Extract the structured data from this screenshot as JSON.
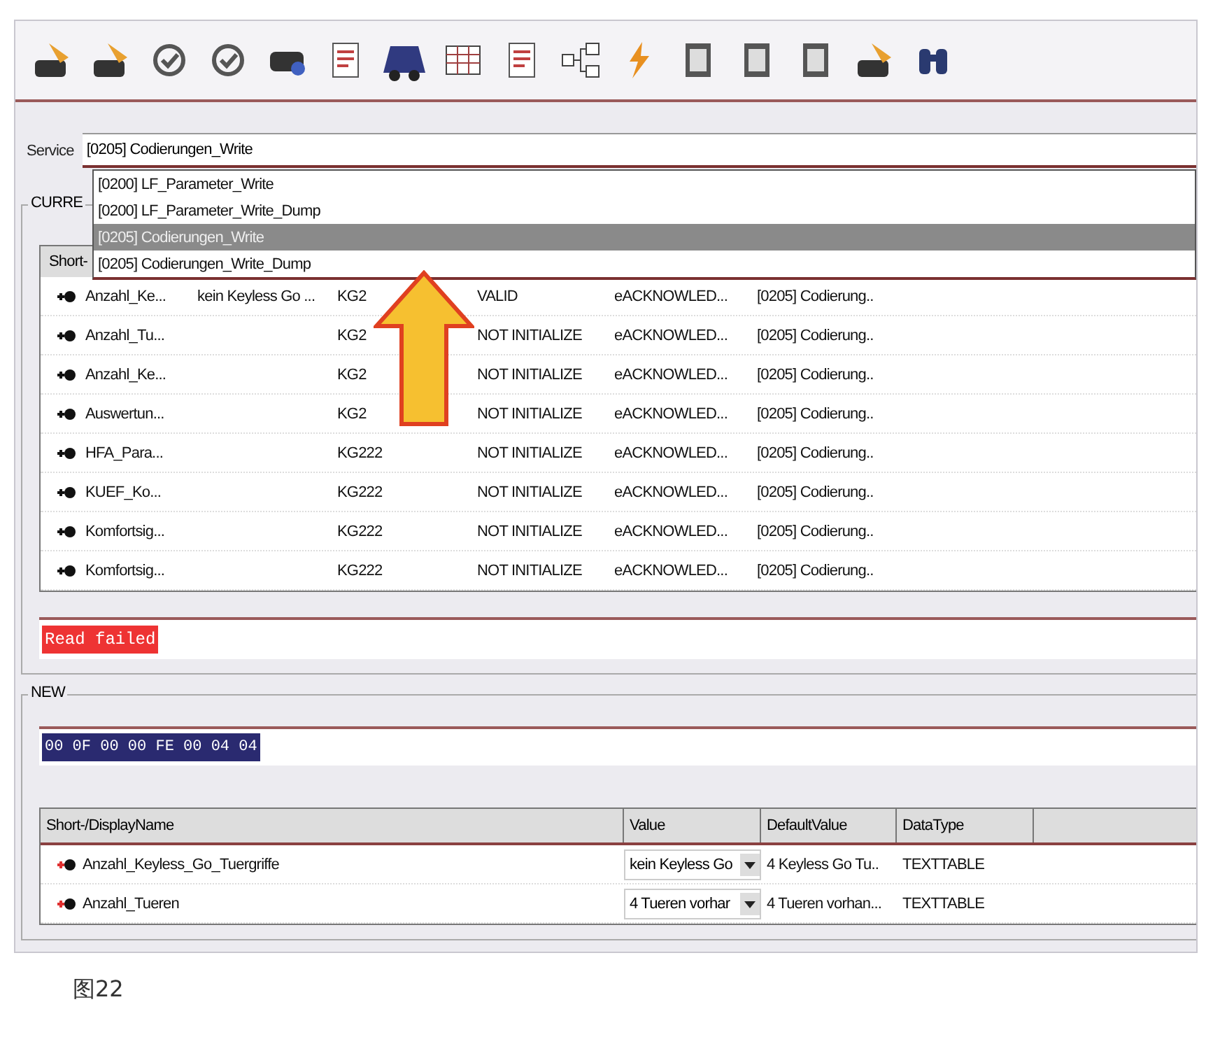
{
  "service": {
    "label": "Service",
    "value": "[0205] Codierungen_Write"
  },
  "dropdown": {
    "options": [
      {
        "label": "[0200] LF_Parameter_Write",
        "selected": false
      },
      {
        "label": "[0200] LF_Parameter_Write_Dump",
        "selected": false
      },
      {
        "label": "[0205] Codierungen_Write",
        "selected": true
      },
      {
        "label": "[0205] Codierungen_Write_Dump",
        "selected": false
      }
    ]
  },
  "current": {
    "title": "CURRE",
    "header": "Short-",
    "rows": [
      {
        "name": "Anzahl_Ke...",
        "value": "kein Keyless Go ...",
        "group": "KG2",
        "status": "VALID",
        "response": "eACKNOWLED...",
        "service": "[0205] Codierung.."
      },
      {
        "name": "Anzahl_Tu...",
        "group": "KG2",
        "status": "NOT INITIALIZE",
        "response": "eACKNOWLED...",
        "service": "[0205] Codierung.."
      },
      {
        "name": "Anzahl_Ke...",
        "group": "KG2",
        "status": "NOT INITIALIZE",
        "response": "eACKNOWLED...",
        "service": "[0205] Codierung.."
      },
      {
        "name": "Auswertun...",
        "group": "KG2",
        "status": "NOT INITIALIZE",
        "response": "eACKNOWLED...",
        "service": "[0205] Codierung.."
      },
      {
        "name": "HFA_Para...",
        "group": "KG222",
        "status": "NOT INITIALIZE",
        "response": "eACKNOWLED...",
        "service": "[0205] Codierung.."
      },
      {
        "name": "KUEF_Ko...",
        "group": "KG222",
        "status": "NOT INITIALIZE",
        "response": "eACKNOWLED...",
        "service": "[0205] Codierung.."
      },
      {
        "name": "Komfortsig...",
        "group": "KG222",
        "status": "NOT INITIALIZE",
        "response": "eACKNOWLED...",
        "service": "[0205] Codierung.."
      },
      {
        "name": "Komfortsig...",
        "group": "KG222",
        "status": "NOT INITIALIZE",
        "response": "eACKNOWLED...",
        "service": "[0205] Codierung.."
      }
    ],
    "message": "Read failed"
  },
  "new": {
    "title": "NEW",
    "hex": "00 0F 00 00 FE 00 04 04",
    "columns": [
      "Short-/DisplayName",
      "Value",
      "DefaultValue",
      "DataType"
    ],
    "rows": [
      {
        "name": "Anzahl_Keyless_Go_Tuergriffe",
        "value": "kein Keyless Go",
        "default": "4 Keyless Go Tu..",
        "type": "TEXTTABLE"
      },
      {
        "name": "Anzahl_Tueren",
        "value": "4 Tueren vorhar",
        "default": "4 Tueren vorhan...",
        "type": "TEXTTABLE"
      }
    ]
  },
  "caption": "图22"
}
